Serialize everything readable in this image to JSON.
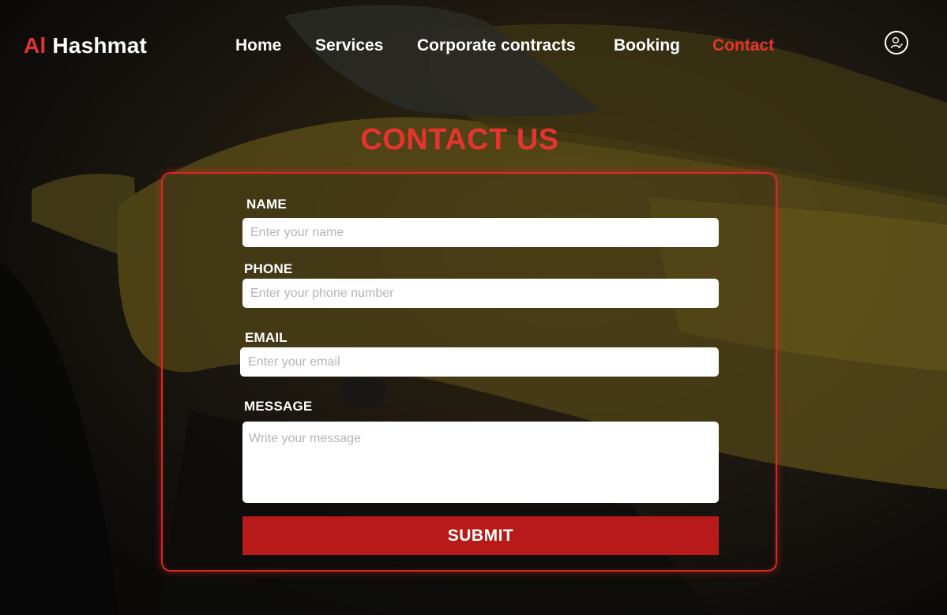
{
  "brand": {
    "accent_part": "Al",
    "rest": " Hashmat"
  },
  "nav": {
    "items": [
      {
        "label": "Home"
      },
      {
        "label": "Services"
      },
      {
        "label": "Corporate contracts"
      },
      {
        "label": "Booking"
      },
      {
        "label": "Contact",
        "active": true
      }
    ],
    "user_icon": "user-avatar-icon"
  },
  "page": {
    "title": "CONTACT US"
  },
  "form": {
    "name": {
      "label": "NAME",
      "placeholder": "Enter your name"
    },
    "phone": {
      "label": "PHONE",
      "placeholder": "Enter your phone number"
    },
    "email": {
      "label": "EMAIL",
      "placeholder": "Enter your email"
    },
    "message": {
      "label": "MESSAGE",
      "placeholder": "Write your message"
    },
    "submit_label": "SUBMIT"
  },
  "colors": {
    "accent": "#e5342f",
    "button": "#b71a18",
    "background": "#0d0c0b",
    "text": "#ffffff"
  }
}
